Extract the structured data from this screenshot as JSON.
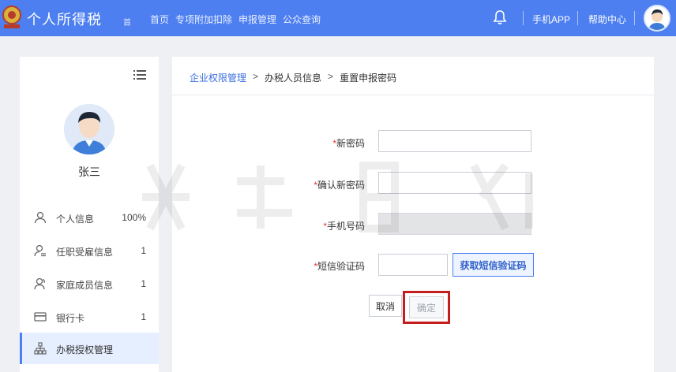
{
  "header": {
    "app_title": "个人所得税",
    "home_glyph": "首",
    "nav": [
      "首页",
      "专项附加扣除",
      "申报管理",
      "公众查询"
    ],
    "mobile_app": "手机APP",
    "help_center": "帮助中心"
  },
  "sidebar": {
    "user_name": "张三",
    "items": [
      {
        "label": "个人信息",
        "value": "100%"
      },
      {
        "label": "任职受雇信息",
        "value": "1"
      },
      {
        "label": "家庭成员信息",
        "value": "1"
      },
      {
        "label": "银行卡",
        "value": "1"
      },
      {
        "label": "办税授权管理",
        "value": ""
      }
    ]
  },
  "breadcrumb": {
    "item1": "企业权限管理",
    "sep": ">",
    "item2": "办税人员信息",
    "item3": "重置申报密码"
  },
  "form": {
    "new_password": {
      "label": "新密码",
      "value": ""
    },
    "confirm_password": {
      "label": "确认新密码",
      "value": ""
    },
    "phone": {
      "label": "手机号码",
      "value": ""
    },
    "sms_code": {
      "label": "短信验证码",
      "value": ""
    },
    "required_mark": "*",
    "sms_button": "获取短信验证码",
    "cancel_button": "取消",
    "confirm_button": "确定"
  },
  "colors": {
    "header_bg": "#4d7ff0",
    "highlight_border": "#c41e1e",
    "required_star": "#e53935"
  }
}
